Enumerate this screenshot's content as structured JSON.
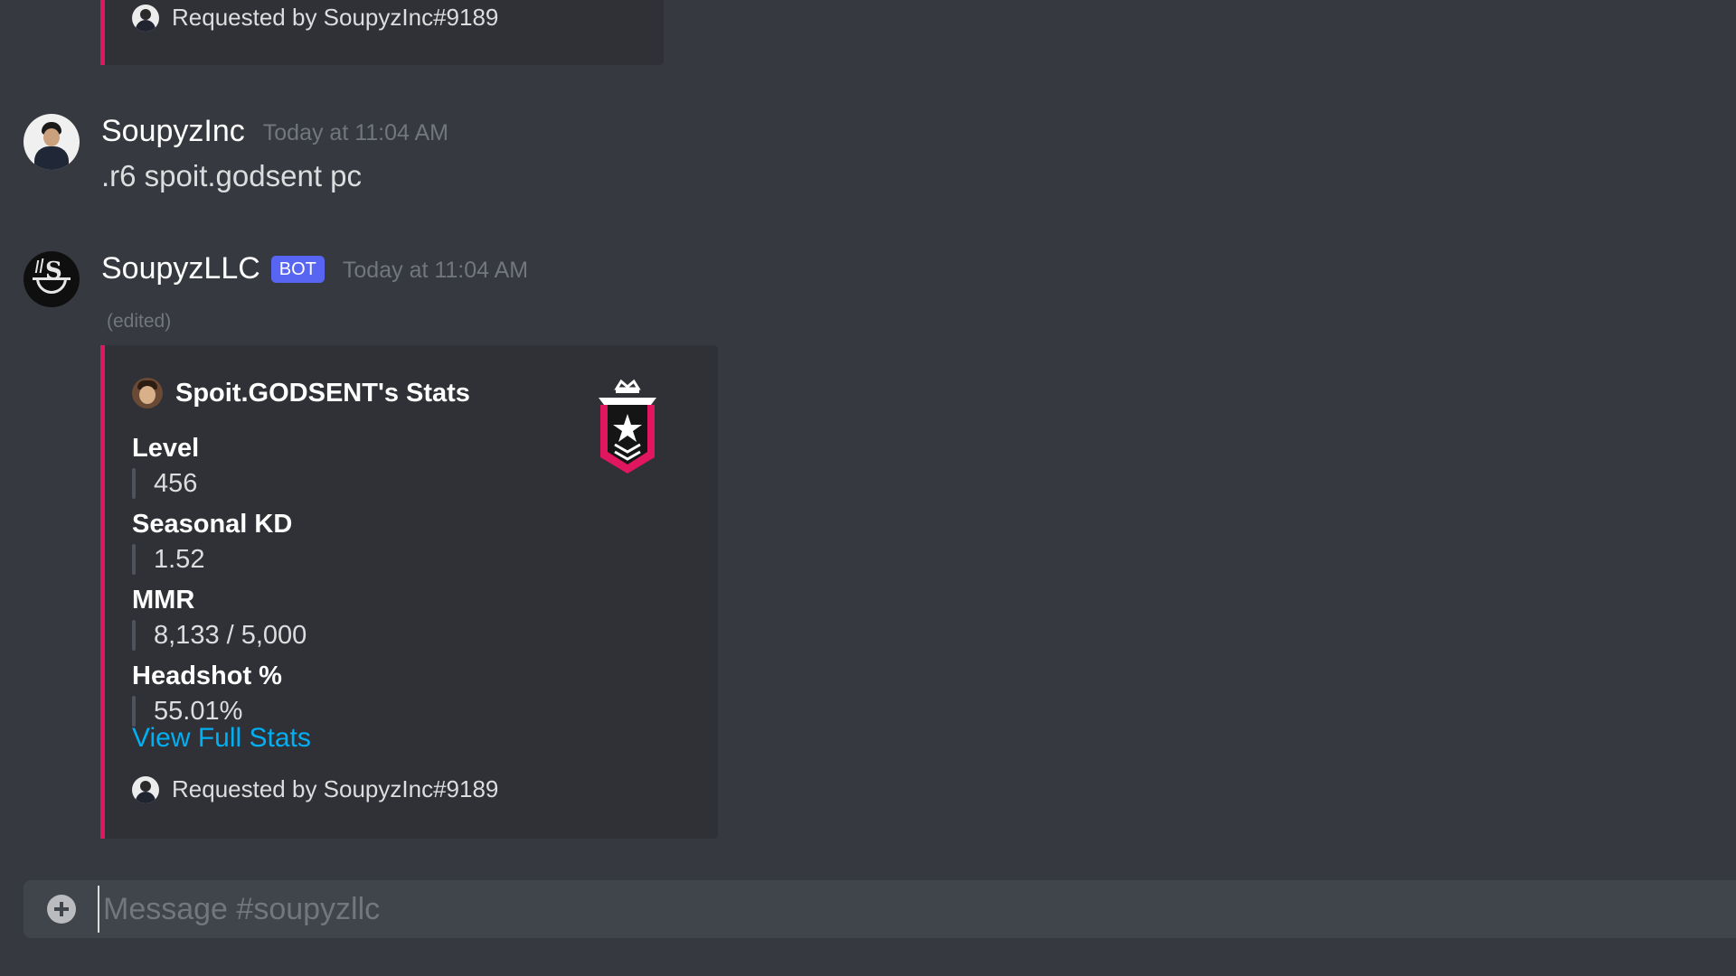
{
  "previous_embed": {
    "footer_text": "Requested by SoupyzInc#9189"
  },
  "messages": [
    {
      "author": "SoupyzInc",
      "timestamp": "Today at 11:04 AM",
      "content": ".r6 spoit.godsent pc",
      "avatar_icon": "user-avatar-icon"
    },
    {
      "author": "SoupyzLLC",
      "bot_tag": "BOT",
      "timestamp": "Today at 11:04 AM",
      "edited": "(edited)",
      "avatar_icon": "soup-bowl-avatar-icon",
      "embed": {
        "accent_color": "#e0165e",
        "author_name": "Spoit.GODSENT's Stats",
        "thumbnail_icon": "rank-champion-badge-icon",
        "fields": [
          {
            "name": "Level",
            "value": "456"
          },
          {
            "name": "Seasonal KD",
            "value": "1.52"
          },
          {
            "name": "MMR",
            "value": "8,133 / 5,000"
          },
          {
            "name": "Headshot %",
            "value": "55.01%"
          }
        ],
        "link_text": "View Full Stats",
        "footer_text": "Requested by SoupyzInc#9189"
      }
    }
  ],
  "input": {
    "placeholder": "Message #soupyzllc",
    "attach_icon": "plus-circle-icon"
  }
}
